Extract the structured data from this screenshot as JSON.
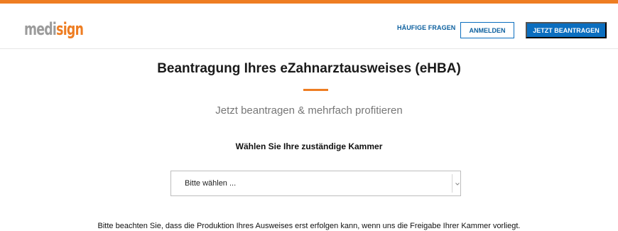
{
  "brand": {
    "logo_part1": "medi",
    "logo_part2": "sign",
    "accent_color": "#ee7d22",
    "primary_color": "#0b6ebf"
  },
  "nav": {
    "faq_label": "HÄUFIGE FRAGEN",
    "login_label": "ANMELDEN",
    "apply_label": "JETZT BEANTRAGEN"
  },
  "main": {
    "title": "Beantragung Ihres eZahnarztausweises (eHBA)",
    "subtitle": "Jetzt beantragen & mehrfach profitieren",
    "select_heading": "Wählen Sie Ihre zuständige Kammer",
    "select": {
      "value": "Bitte wählen ...",
      "icon": "chevron-down-icon"
    },
    "notice": "Bitte beachten Sie, dass die Produktion Ihres Ausweises erst erfolgen kann, wenn uns die Freigabe Ihrer Kammer vorliegt."
  }
}
